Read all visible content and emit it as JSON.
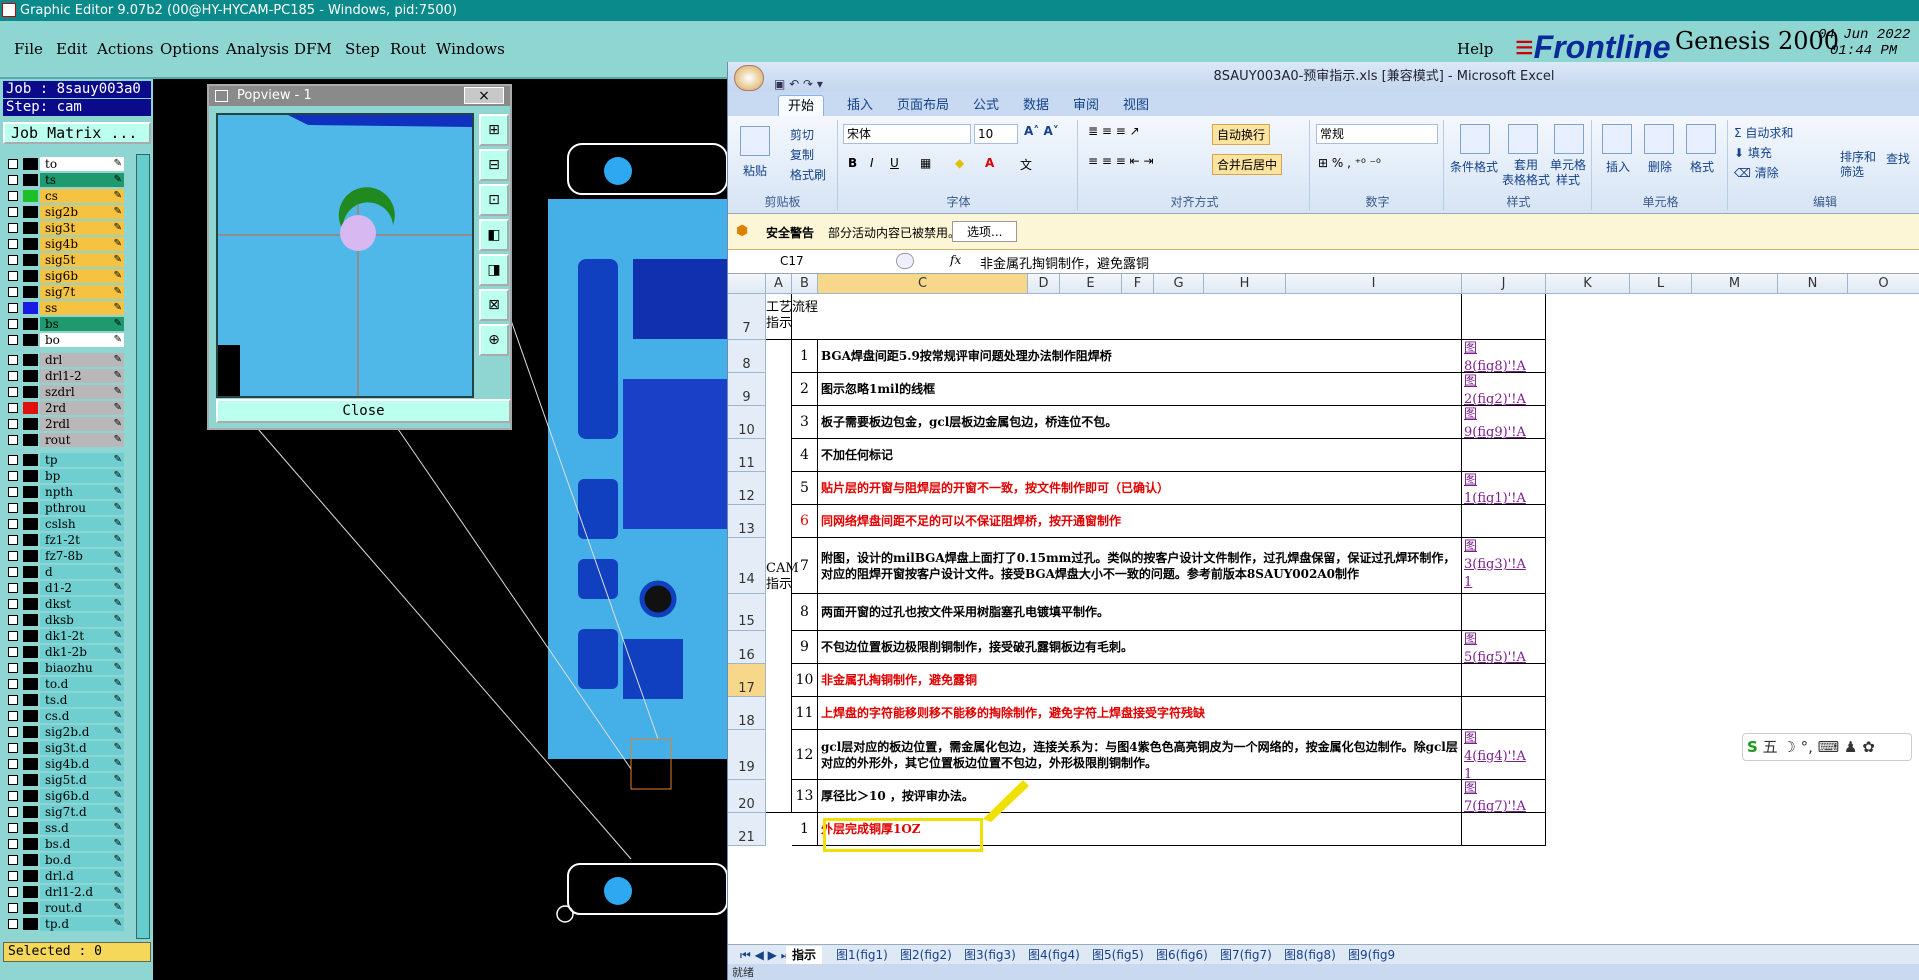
{
  "genesis": {
    "title": "Graphic Editor 9.07b2 (00@HY-HYCAM-PC185 - Windows, pid:7500)",
    "menus": [
      "File",
      "Edit",
      "Actions",
      "Options",
      "Analysis",
      "DFM",
      "Step",
      "Rout",
      "Windows"
    ],
    "help": "Help",
    "logo": "Frontline",
    "product": "Genesis 2000",
    "date": "04 Jun 2022",
    "time": "01:44 PM",
    "job_label": "Job : 8sauy003a0",
    "step_label": "Step: cam",
    "job_matrix": "Job Matrix ...",
    "selected": "Selected : 0",
    "layers": [
      {
        "name": "to",
        "color": "#ffffff",
        "sw": "#000000"
      },
      {
        "name": "ts",
        "color": "#1f9a6e",
        "sw": "#000000"
      },
      {
        "name": "cs",
        "color": "#f5c242",
        "sw": "#1fbf2a"
      },
      {
        "name": "sig2b",
        "color": "#f5c242",
        "sw": "#000000"
      },
      {
        "name": "sig3t",
        "color": "#f5c242",
        "sw": "#000000"
      },
      {
        "name": "sig4b",
        "color": "#f5c242",
        "sw": "#000000"
      },
      {
        "name": "sig5t",
        "color": "#f5c242",
        "sw": "#000000"
      },
      {
        "name": "sig6b",
        "color": "#f5c242",
        "sw": "#000000"
      },
      {
        "name": "sig7t",
        "color": "#f5c242",
        "sw": "#000000"
      },
      {
        "name": "ss",
        "color": "#f5c242",
        "sw": "#1a1ae0"
      },
      {
        "name": "bs",
        "color": "#1f9a6e",
        "sw": "#000000"
      },
      {
        "name": "bo",
        "color": "#ffffff",
        "sw": "#000000"
      },
      {
        "name": "drl",
        "color": "#b8b8b8",
        "sw": "#000000"
      },
      {
        "name": "drl1-2",
        "color": "#b8b8b8",
        "sw": "#000000"
      },
      {
        "name": "szdrl",
        "color": "#b8b8b8",
        "sw": "#000000"
      },
      {
        "name": "2rd",
        "color": "#b8b8b8",
        "sw": "#e01010"
      },
      {
        "name": "2rdl",
        "color": "#b8b8b8",
        "sw": "#000000"
      },
      {
        "name": "rout",
        "color": "#b8b8b8",
        "sw": "#000000"
      },
      {
        "name": "tp",
        "color": "#6fcfd0",
        "sw": "#000000"
      },
      {
        "name": "bp",
        "color": "#6fcfd0",
        "sw": "#000000"
      },
      {
        "name": "npth",
        "color": "#6fcfd0",
        "sw": "#000000"
      },
      {
        "name": "pthrou",
        "color": "#6fcfd0",
        "sw": "#000000"
      },
      {
        "name": "cslsh",
        "color": "#6fcfd0",
        "sw": "#000000"
      },
      {
        "name": "fz1-2t",
        "color": "#6fcfd0",
        "sw": "#000000"
      },
      {
        "name": "fz7-8b",
        "color": "#6fcfd0",
        "sw": "#000000"
      },
      {
        "name": "d",
        "color": "#6fcfd0",
        "sw": "#000000"
      },
      {
        "name": "d1-2",
        "color": "#6fcfd0",
        "sw": "#000000"
      },
      {
        "name": "dkst",
        "color": "#6fcfd0",
        "sw": "#000000"
      },
      {
        "name": "dksb",
        "color": "#6fcfd0",
        "sw": "#000000"
      },
      {
        "name": "dk1-2t",
        "color": "#6fcfd0",
        "sw": "#000000"
      },
      {
        "name": "dk1-2b",
        "color": "#6fcfd0",
        "sw": "#000000"
      },
      {
        "name": "biaozhu",
        "color": "#6fcfd0",
        "sw": "#000000"
      },
      {
        "name": "to.d",
        "color": "#6fcfd0",
        "sw": "#000000"
      },
      {
        "name": "ts.d",
        "color": "#6fcfd0",
        "sw": "#000000"
      },
      {
        "name": "cs.d",
        "color": "#6fcfd0",
        "sw": "#000000"
      },
      {
        "name": "sig2b.d",
        "color": "#6fcfd0",
        "sw": "#000000"
      },
      {
        "name": "sig3t.d",
        "color": "#6fcfd0",
        "sw": "#000000"
      },
      {
        "name": "sig4b.d",
        "color": "#6fcfd0",
        "sw": "#000000"
      },
      {
        "name": "sig5t.d",
        "color": "#6fcfd0",
        "sw": "#000000"
      },
      {
        "name": "sig6b.d",
        "color": "#6fcfd0",
        "sw": "#000000"
      },
      {
        "name": "sig7t.d",
        "color": "#6fcfd0",
        "sw": "#000000"
      },
      {
        "name": "ss.d",
        "color": "#6fcfd0",
        "sw": "#000000"
      },
      {
        "name": "bs.d",
        "color": "#6fcfd0",
        "sw": "#000000"
      },
      {
        "name": "bo.d",
        "color": "#6fcfd0",
        "sw": "#000000"
      },
      {
        "name": "drl.d",
        "color": "#6fcfd0",
        "sw": "#000000"
      },
      {
        "name": "drl1-2.d",
        "color": "#6fcfd0",
        "sw": "#000000"
      },
      {
        "name": "rout.d",
        "color": "#6fcfd0",
        "sw": "#000000"
      },
      {
        "name": "tp.d",
        "color": "#6fcfd0",
        "sw": "#000000"
      }
    ],
    "popview": {
      "title": "Popview - 1",
      "close": "Close",
      "close_x": "×"
    }
  },
  "excel": {
    "title": "8SAUY003A0-预审指示.xls [兼容模式] - Microsoft Excel",
    "tabs": [
      "开始",
      "插入",
      "页面布局",
      "公式",
      "数据",
      "审阅",
      "视图"
    ],
    "ribbon": {
      "clipboard": {
        "label": "剪贴板",
        "paste": "粘贴",
        "cut": "剪切",
        "copy": "复制",
        "format_painter": "格式刷"
      },
      "font": {
        "label": "字体",
        "name": "宋体",
        "size": "10"
      },
      "alignment": {
        "label": "对齐方式",
        "wrap": "自动换行",
        "merge": "合并后居中"
      },
      "number": {
        "label": "数字",
        "format": "常规"
      },
      "styles": {
        "label": "样式",
        "cond": "条件格式",
        "table": "套用\n表格格式",
        "cell": "单元格\n样式"
      },
      "cells": {
        "label": "单元格",
        "insert": "插入",
        "delete": "删除",
        "format": "格式"
      },
      "editing": {
        "label": "编辑",
        "autosum": "自动求和",
        "fill": "填充",
        "clear": "清除",
        "sort": "排序和\n筛选",
        "find": "查找"
      }
    },
    "security": {
      "label": "安全警告",
      "message": "部分活动内容已被禁用。",
      "options": "选项..."
    },
    "namebox": "C17",
    "formula": "非金属孔掏铜制作，避免露铜",
    "columns": [
      "A",
      "B",
      "C",
      "D",
      "E",
      "F",
      "G",
      "H",
      "I",
      "J",
      "K",
      "L",
      "M",
      "N",
      "O"
    ],
    "rows": [
      {
        "n": "7",
        "no": "",
        "text": "",
        "link": "",
        "red": false
      },
      {
        "n": "8",
        "no": "1",
        "text": "BGA焊盘间距5.9按常规评审问题处理办法制作阻焊桥",
        "link": "图\n8(fig8)'!A",
        "red": false
      },
      {
        "n": "9",
        "no": "2",
        "text": "图示忽略1mil的线框",
        "link": "图\n2(fig2)'!A",
        "red": false
      },
      {
        "n": "10",
        "no": "3",
        "text": "板子需要板边包金，gcl层板边金属包边，桥连位不包。",
        "link": "图\n9(fig9)'!A",
        "red": false
      },
      {
        "n": "11",
        "no": "4",
        "text": "不加任何标记",
        "link": "",
        "red": false
      },
      {
        "n": "12",
        "no": "5",
        "text": "贴片层的开窗与阻焊层的开窗不一致，按文件制作即可（已确认）",
        "link": "图\n1(fig1)'!A",
        "red": true
      },
      {
        "n": "13",
        "no": "6",
        "text": "同网络焊盘间距不足的可以不保证阻焊桥，按开通窗制作",
        "link": "",
        "red": true
      },
      {
        "n": "14",
        "no": "7",
        "text": "附图，设计的milBGA焊盘上面打了0.15mm过孔。类似的按客户设计文件制作，过孔焊盘保留，保证过孔焊环制作，对应的阻焊开窗按客户设计文件。接受BGA焊盘大小不一致的问题。参考前版本8SAUY002A0制作",
        "link": "图\n3(fig3)'!A\n1",
        "red": false
      },
      {
        "n": "15",
        "no": "8",
        "text": "两面开窗的过孔也按文件采用树脂塞孔电镀填平制作。",
        "link": "",
        "red": false
      },
      {
        "n": "16",
        "no": "9",
        "text": "不包边位置板边极限削铜制作，接受破孔露铜板边有毛刺。",
        "link": "图\n5(fig5)'!A",
        "red": false
      },
      {
        "n": "17",
        "no": "10",
        "text": "非金属孔掏铜制作，避免露铜",
        "link": "",
        "red": true
      },
      {
        "n": "18",
        "no": "11",
        "text": "上焊盘的字符能移则移不能移的掏除制作，避免字符上焊盘接受字符残缺",
        "link": "",
        "red": true
      },
      {
        "n": "19",
        "no": "12",
        "text": "gcl层对应的板边位置，需金属化包边，连接关系为：与图4紫色色高亮铜皮为一个网络的，按金属化包边制作。除gcl层对应的外形外，其它位置板边位置不包边，外形极限削铜制作。",
        "link": "图\n4(fig4)'!A\n1",
        "red": false
      },
      {
        "n": "20",
        "no": "13",
        "text": "厚径比＞10 ，按评审办法。",
        "link": "图\n7(fig7)'!A",
        "red": false
      },
      {
        "n": "21",
        "no": "1",
        "text": "外层完成铜厚1OZ",
        "link": "",
        "red": true
      }
    ],
    "header_a": "工艺流程\n指示",
    "cam_label": "CAM\n指示",
    "sheets": [
      "指示",
      "图1(fig1)",
      "图2(fig2)",
      "图3(fig3)",
      "图4(fig4)",
      "图5(fig5)",
      "图6(fig6)",
      "图7(fig7)",
      "图8(fig8)",
      "图9(fig9"
    ],
    "status": "就绪"
  },
  "ime": {
    "text": "五"
  }
}
